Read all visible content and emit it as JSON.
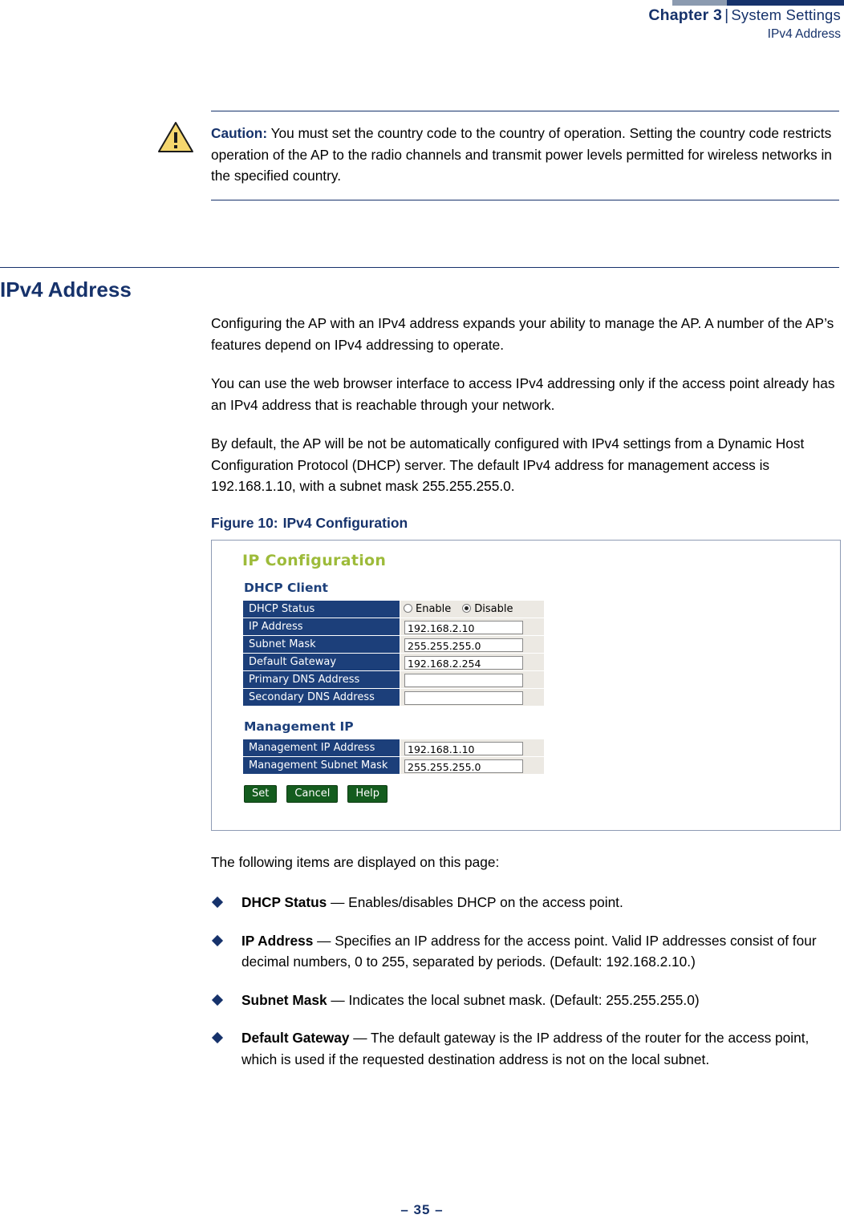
{
  "header": {
    "chapter_label": "Chapter 3",
    "separator": "|",
    "section_label": "System Settings",
    "subtitle": "IPv4 Address"
  },
  "caution": {
    "icon": "warning-triangle-icon",
    "label": "Caution:",
    "text": " You must set the country code to the country of operation. Setting the country code restricts operation of the AP to the radio channels and transmit power levels permitted for wireless networks in the specified country."
  },
  "section": {
    "title": "IPv4 Address",
    "paragraphs": [
      "Configuring the AP with an IPv4 address expands your ability to manage the AP. A number of the AP’s features depend on IPv4 addressing to operate.",
      "You can use the web browser interface to access IPv4 addressing only if the access point already has an IPv4 address that is reachable through your network.",
      "By default, the AP will be not be automatically configured with IPv4 settings from a Dynamic Host Configuration Protocol (DHCP) server. The default IPv4 address for management access is 192.168.1.10, with a subnet mask 255.255.255.0."
    ]
  },
  "figure": {
    "number": "Figure 10:",
    "title": "IPv4 Configuration",
    "screenshot": {
      "title": "IP Configuration",
      "sections": [
        {
          "heading": "DHCP Client",
          "rows": [
            {
              "label": "DHCP Status",
              "type": "radio",
              "options": [
                "Enable",
                "Disable"
              ],
              "selected": "Disable"
            },
            {
              "label": "IP Address",
              "type": "text",
              "value": "192.168.2.10"
            },
            {
              "label": "Subnet Mask",
              "type": "text",
              "value": "255.255.255.0"
            },
            {
              "label": "Default Gateway",
              "type": "text",
              "value": "192.168.2.254"
            },
            {
              "label": "Primary DNS Address",
              "type": "text",
              "value": ""
            },
            {
              "label": "Secondary DNS Address",
              "type": "text",
              "value": ""
            }
          ]
        },
        {
          "heading": "Management IP",
          "rows": [
            {
              "label": "Management IP Address",
              "type": "text",
              "value": "192.168.1.10"
            },
            {
              "label": "Management Subnet Mask",
              "type": "text",
              "value": "255.255.255.0"
            }
          ]
        }
      ],
      "buttons": [
        "Set",
        "Cancel",
        "Help"
      ]
    }
  },
  "items_intro": "The following items are displayed on this page:",
  "items": [
    {
      "term": "DHCP Status",
      "desc": " — Enables/disables DHCP on the access point."
    },
    {
      "term": "IP Address",
      "desc": " — Specifies an IP address for the access point. Valid IP addresses consist of four decimal numbers, 0 to 255, separated by periods. (Default: 192.168.2.10.)"
    },
    {
      "term": "Subnet Mask",
      "desc": " — Indicates the local subnet mask. (Default: 255.255.255.0)"
    },
    {
      "term": "Default Gateway",
      "desc": " — The default gateway is the IP address of the router for the access point, which is used if the requested destination address is not on the local subnet."
    }
  ],
  "footer": "–  35  –"
}
